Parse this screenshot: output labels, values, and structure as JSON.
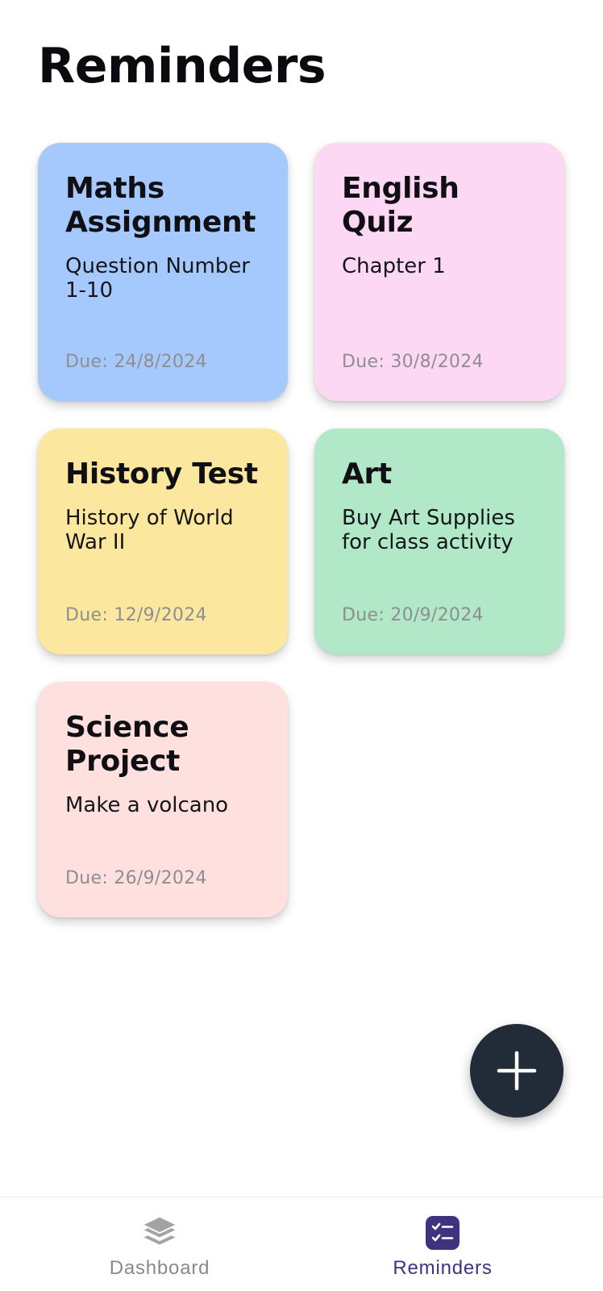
{
  "page": {
    "title": "Reminders"
  },
  "reminders": [
    {
      "title": "Maths Assignment",
      "description": "Question Number 1-10",
      "due": "Due: 24/8/2024",
      "color": "#a5c8fd"
    },
    {
      "title": "English Quiz",
      "description": "Chapter 1",
      "due": "Due: 30/8/2024",
      "color": "#fdd8f4"
    },
    {
      "title": "History Test",
      "description": "History of World War II",
      "due": "Due: 12/9/2024",
      "color": "#fce79f"
    },
    {
      "title": "Art",
      "description": "Buy Art Supplies for class activity",
      "due": "Due: 20/9/2024",
      "color": "#b1e9c8"
    },
    {
      "title": "Science Project",
      "description": "Make a volcano",
      "due": "Due: 26/9/2024",
      "color": "#fee0de"
    }
  ],
  "fab": {
    "icon": "plus-icon",
    "color": "#222b38"
  },
  "nav": {
    "items": [
      {
        "label": "Dashboard",
        "icon": "layers-icon",
        "active": false
      },
      {
        "label": "Reminders",
        "icon": "checklist-icon",
        "active": true
      }
    ],
    "active_color": "#3f3380",
    "inactive_color": "#8a8a8e"
  }
}
